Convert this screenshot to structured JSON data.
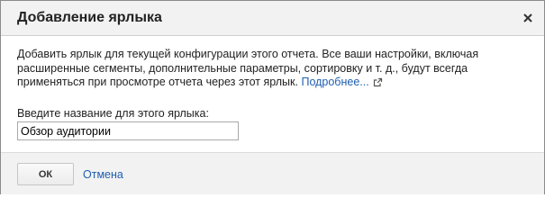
{
  "dialog": {
    "title": "Добавление ярлыка",
    "close_icon": "close-icon",
    "description": "Добавить ярлык для текущей конфигурации этого отчета. Все ваши настройки, включая расширенные сегменты, дополнительные параметры, сортировку и т. д., будут всегда применяться при просмотре отчета через этот ярлык.",
    "learn_more_label": "Подробнее...",
    "learn_more_icon": "external-link-icon",
    "name_field_label": "Введите название для этого ярлыка:",
    "name_field_value": "Обзор аудитории",
    "ok_label": "ОК",
    "cancel_label": "Отмена"
  },
  "colors": {
    "link": "#1f5fb0",
    "header_bg": "#f2f2f2",
    "border": "#8a8a8a"
  }
}
